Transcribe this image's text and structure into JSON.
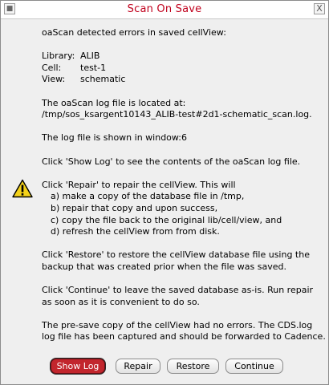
{
  "window": {
    "title": "Scan On Save",
    "close_glyph": "X"
  },
  "message": {
    "intro": "oaScan detected errors in saved cellView:",
    "library_label": "Library:",
    "library_value": "ALIB",
    "cell_label": "Cell:",
    "cell_value": "test-1",
    "view_label": "View:",
    "view_value": "schematic",
    "log_located_line1": "The oaScan log file is located at:",
    "log_located_line2": "/tmp/sos_ksargent10143_ALIB-test#2d1-schematic_scan.log.",
    "log_window": "The log file is shown in window:6",
    "show_log_hint": "Click 'Show Log' to see the contents of the oaScan log file.",
    "repair_intro": "Click 'Repair' to repair the cellView. This will",
    "repair_steps": [
      "a) make a copy of the database file in /tmp,",
      "b) repair that copy and upon success,",
      "c) copy the file back to the original lib/cell/view, and",
      "d) refresh the cellView from from disk."
    ],
    "restore_line1": "Click 'Restore' to restore the cellView database file using the",
    "restore_line2": "backup that was created prior when the file was saved.",
    "continue_line1": "Click 'Continue' to leave the saved database as-is. Run repair",
    "continue_line2": "as soon as it is convenient to do so.",
    "presave_line1": "The pre-save copy of the cellView had no errors. The CDS.log",
    "presave_line2": "log file has been captured and should be forwarded to Cadence."
  },
  "buttons": {
    "show_log": "Show Log",
    "repair": "Repair",
    "restore": "Restore",
    "continue": "Continue"
  },
  "icons": {
    "warning": "warning-icon",
    "window": "window-menu-icon",
    "close": "close-icon"
  },
  "colors": {
    "title": "#c0001c",
    "default_button": "#c2262d",
    "warning_fill": "#f4d21a"
  }
}
